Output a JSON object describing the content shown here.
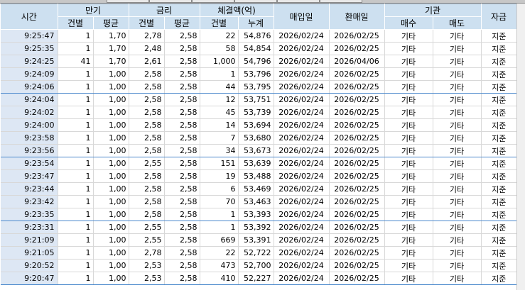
{
  "header": {
    "time": "시간",
    "maturity": "만기",
    "rate": "금리",
    "amount": "체결액(억)",
    "buy_date": "매입일",
    "repurchase_date": "환매일",
    "institution": "기관",
    "fund": "자금",
    "maturity_count": "건별",
    "maturity_avg": "평균",
    "rate_each": "건별",
    "rate_avg": "평균",
    "amount_each": "건별",
    "amount_cumulative": "누계",
    "inst_buy": "매수",
    "inst_sell": "매도"
  },
  "rows": [
    [
      "9:25:47",
      "1",
      "1,70",
      "2,78",
      "2,58",
      "22",
      "54,876",
      "2026/02/24",
      "2026/02/25",
      "기타",
      "기타",
      "지준"
    ],
    [
      "9:25:35",
      "1",
      "1,70",
      "2,48",
      "2,58",
      "58",
      "54,854",
      "2026/02/24",
      "2026/02/25",
      "기타",
      "기타",
      "지준"
    ],
    [
      "9:24:25",
      "41",
      "1,70",
      "2,61",
      "2,58",
      "1,000",
      "54,796",
      "2026/02/24",
      "2026/04/06",
      "기타",
      "기타",
      "지준"
    ],
    [
      "9:24:09",
      "1",
      "1,00",
      "2,58",
      "2,58",
      "1",
      "53,796",
      "2026/02/24",
      "2026/02/25",
      "기타",
      "기타",
      "지준"
    ],
    [
      "9:24:06",
      "1",
      "1,00",
      "2,58",
      "2,58",
      "44",
      "53,795",
      "2026/02/24",
      "2026/02/25",
      "기타",
      "기타",
      "지준"
    ],
    [
      "9:24:04",
      "1",
      "1,00",
      "2,58",
      "2,58",
      "12",
      "53,751",
      "2026/02/24",
      "2026/02/25",
      "기타",
      "기타",
      "지준"
    ],
    [
      "9:24:02",
      "1",
      "1,00",
      "2,58",
      "2,58",
      "45",
      "53,739",
      "2026/02/24",
      "2026/02/25",
      "기타",
      "기타",
      "지준"
    ],
    [
      "9:24:00",
      "1",
      "1,00",
      "2,58",
      "2,58",
      "14",
      "53,694",
      "2026/02/24",
      "2026/02/25",
      "기타",
      "기타",
      "지준"
    ],
    [
      "9:23:58",
      "1",
      "1,00",
      "2,58",
      "2,58",
      "7",
      "53,680",
      "2026/02/24",
      "2026/02/25",
      "기타",
      "기타",
      "지준"
    ],
    [
      "9:23:56",
      "1",
      "1,00",
      "2,58",
      "2,58",
      "34",
      "53,673",
      "2026/02/24",
      "2026/02/25",
      "기타",
      "기타",
      "지준"
    ],
    [
      "9:23:54",
      "1",
      "1,00",
      "2,55",
      "2,58",
      "151",
      "53,639",
      "2026/02/24",
      "2026/02/25",
      "기타",
      "기타",
      "지준"
    ],
    [
      "9:23:47",
      "1",
      "1,00",
      "2,58",
      "2,58",
      "19",
      "53,488",
      "2026/02/24",
      "2026/02/25",
      "기타",
      "기타",
      "지준"
    ],
    [
      "9:23:44",
      "1",
      "1,00",
      "2,58",
      "2,58",
      "6",
      "53,469",
      "2026/02/24",
      "2026/02/25",
      "기타",
      "기타",
      "지준"
    ],
    [
      "9:23:42",
      "1",
      "1,00",
      "2,58",
      "2,58",
      "70",
      "53,463",
      "2026/02/24",
      "2026/02/25",
      "기타",
      "기타",
      "지준"
    ],
    [
      "9:23:35",
      "1",
      "1,00",
      "2,58",
      "2,58",
      "1",
      "53,393",
      "2026/02/24",
      "2026/02/25",
      "기타",
      "기타",
      "지준"
    ],
    [
      "9:23:31",
      "1",
      "1,00",
      "2,55",
      "2,58",
      "1",
      "53,392",
      "2026/02/24",
      "2026/02/25",
      "기타",
      "기타",
      "지준"
    ],
    [
      "9:21:09",
      "1",
      "1,00",
      "2,55",
      "2,58",
      "669",
      "53,391",
      "2026/02/24",
      "2026/02/25",
      "기타",
      "기타",
      "지준"
    ],
    [
      "9:21:05",
      "1",
      "1,00",
      "2,78",
      "2,58",
      "22",
      "52,722",
      "2026/02/24",
      "2026/02/25",
      "기타",
      "기타",
      "지준"
    ],
    [
      "9:20:52",
      "1",
      "1,00",
      "2,53",
      "2,58",
      "473",
      "52,700",
      "2026/02/24",
      "2026/02/25",
      "기타",
      "기타",
      "지준"
    ],
    [
      "9:20:47",
      "1",
      "1,00",
      "2,53",
      "2,58",
      "410",
      "52,227",
      "2026/02/24",
      "2026/02/25",
      "기타",
      "기타",
      "지준"
    ]
  ],
  "colors": {
    "header_bg": "#cde0f0",
    "time_bg": "#dde7f4",
    "group_divider": "#4a88cc",
    "grid_line": "#d8d8d8"
  }
}
